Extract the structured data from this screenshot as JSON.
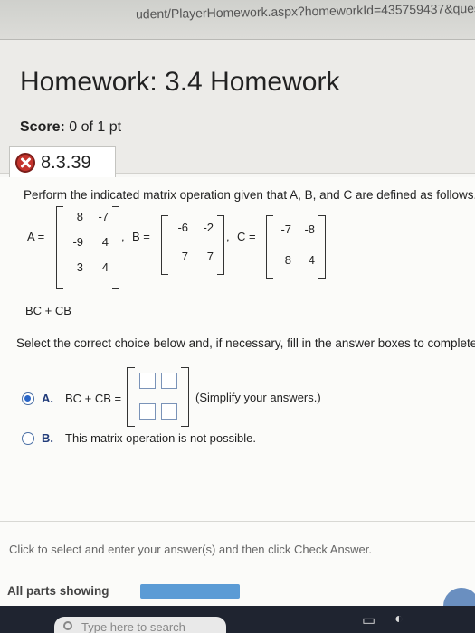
{
  "browser": {
    "url": "udent/PlayerHomework.aspx?homeworkId=435759437&question"
  },
  "homework": {
    "title": "Homework: 3.4 Homework",
    "score_label": "Score:",
    "score_value": "0 of 1 pt"
  },
  "question": {
    "number": "8.3.39",
    "status_icon": "x-icon",
    "instruction": "Perform the indicated matrix operation given that A, B, and C are defined as follows.",
    "matrices": {
      "A": {
        "label": "A =",
        "rows": [
          [
            "8",
            "-7"
          ],
          [
            "-9",
            "4"
          ],
          [
            "3",
            "4"
          ]
        ]
      },
      "B": {
        "label": "B =",
        "rows": [
          [
            "-6",
            "-2"
          ],
          [
            "7",
            "7"
          ]
        ]
      },
      "C": {
        "label": "C =",
        "rows": [
          [
            "-7",
            "-8"
          ],
          [
            "8",
            "4"
          ]
        ]
      }
    },
    "expression": "BC + CB",
    "select_prompt": "Select the correct choice below and, if necessary, fill in the answer boxes to complete"
  },
  "options": [
    {
      "letter": "A.",
      "text": "BC + CB =",
      "suffix": "(Simplify your answers.)",
      "checked": true
    },
    {
      "letter": "B.",
      "text": "This matrix operation is not possible.",
      "checked": false
    }
  ],
  "footer": {
    "hint": "Click to select and enter your answer(s) and then click Check Answer.",
    "parts_label": "All parts showing",
    "progress": 1.0
  },
  "taskbar": {
    "search_placeholder": "Type here to search"
  }
}
